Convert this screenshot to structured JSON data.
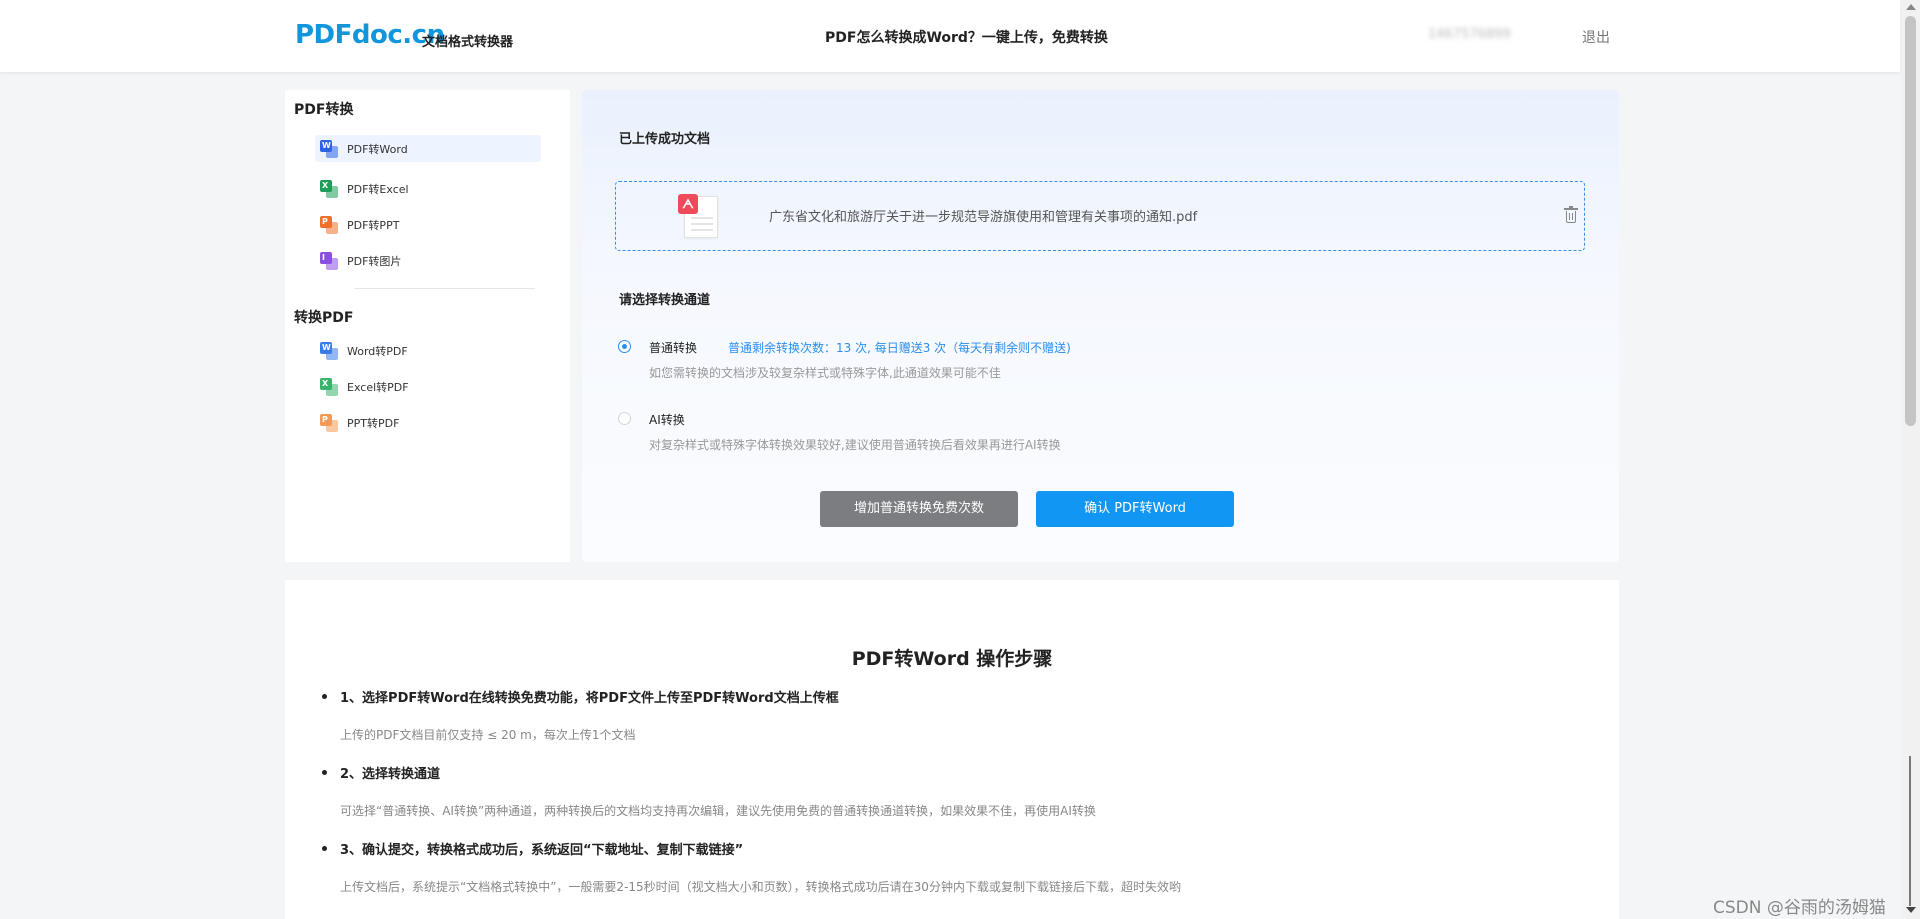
{
  "header": {
    "logo": "PDFdoc.cn",
    "logo_sub": "文档格式转换器",
    "center_title": "PDF怎么转换成Word？一键上传，免费转换",
    "user_text": "1467576899",
    "logout": "退出"
  },
  "sidebar": {
    "group1_title": "PDF转换",
    "group1_items": [
      {
        "label": "PDF转Word",
        "icon": "word-file-icon",
        "color": "#2f63e6"
      },
      {
        "label": "PDF转Excel",
        "icon": "excel-file-icon",
        "color": "#1f9c5a"
      },
      {
        "label": "PDF转PPT",
        "icon": "ppt-file-icon",
        "color": "#f0702a"
      },
      {
        "label": "PDF转图片",
        "icon": "image-file-icon",
        "color": "#8a4fe0"
      }
    ],
    "group2_title": "转换PDF",
    "group2_items": [
      {
        "label": "Word转PDF",
        "icon": "word-file-icon",
        "color": "#3b7be8"
      },
      {
        "label": "Excel转PDF",
        "icon": "excel-file-icon",
        "color": "#39b36e"
      },
      {
        "label": "PPT转PDF",
        "icon": "ppt-file-icon",
        "color": "#f59a52"
      }
    ]
  },
  "main": {
    "uploaded_title": "已上传成功文档",
    "file_name": "广东省文化和旅游厅关于进一步规范导游旗使用和管理有关事项的通知.pdf",
    "channel_title": "请选择转换通道",
    "options": [
      {
        "label": "普通转换",
        "hint": "普通剩余转换次数：13 次, 每日赠送3 次（每天有剩余则不赠送)",
        "desc": "如您需转换的文档涉及较复杂样式或特殊字体,此通道效果可能不佳",
        "selected": true
      },
      {
        "label": "AI转换",
        "hint": "",
        "desc": "对复杂样式或特殊字体转换效果较好,建议使用普通转换后看效果再进行AI转换",
        "selected": false
      }
    ],
    "btn_add": "增加普通转换免费次数",
    "btn_confirm": "确认 PDF转Word"
  },
  "steps": {
    "title": "PDF转Word 操作步骤",
    "items": [
      {
        "head": "1、选择PDF转Word在线转换免费功能，将PDF文件上传至PDF转Word文档上传框",
        "desc": "上传的PDF文档目前仅支持 ≤ 20 m，每次上传1个文档"
      },
      {
        "head": "2、选择转换通道",
        "desc": "可选择“普通转换、AI转换”两种通道，两种转换后的文档均支持再次编辑，建议先使用免费的普通转换通道转换，如果效果不佳，再使用AI转换"
      },
      {
        "head": "3、确认提交，转换格式成功后，系统返回“下载地址、复制下载链接”",
        "desc": "上传文档后，系统提示“文档格式转换中”，一般需要2-15秒时间（视文档大小和页数），转换格式成功后请在30分钟内下载或复制下载链接后下载，超时失效哟"
      }
    ]
  },
  "watermark": "CSDN @谷雨的汤姆猫"
}
